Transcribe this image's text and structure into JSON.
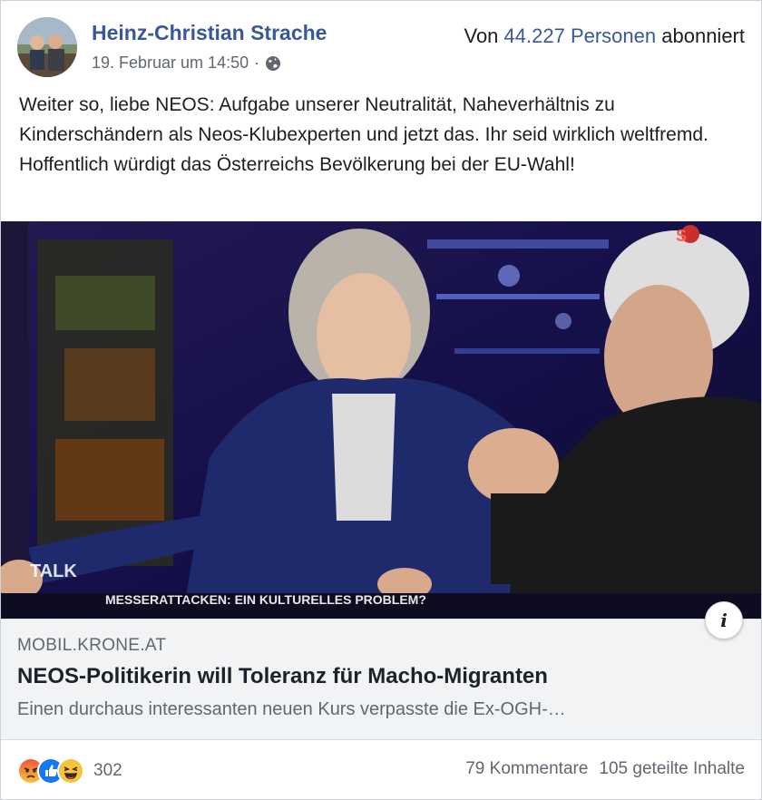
{
  "post": {
    "author": "Heinz-Christian Strache",
    "timestamp": "19. Februar um 14:50",
    "separator": "·",
    "privacy_icon": "globe-icon",
    "subscribed_prefix": "Von",
    "subscribed_count": "44.227 Personen",
    "subscribed_suffix": "abonniert",
    "text": "Weiter so, liebe NEOS: Aufgabe unserer Neutralität, Naheverhältnis zu Kinderschändern als Neos-Klubexperten und jetzt das. Ihr seid wirklich weltfremd. Hoffentlich würdigt das Österreichs Bevölkerung bei der EU-Wahl!"
  },
  "image": {
    "caption_tag": "TALK",
    "caption_text": "MESSERATTACKEN: EIN KULTURELLES PROBLEM?",
    "channel_logo": "S"
  },
  "link": {
    "domain": "MOBIL.KRONE.AT",
    "title": "NEOS-Politikerin will Toleranz für Macho-Migranten",
    "description": "Einen durchaus interessanten neuen Kurs verpasste die Ex-OGH-…",
    "info_label": "i"
  },
  "footer": {
    "reaction_icons": [
      "angry-icon",
      "like-icon",
      "haha-icon"
    ],
    "reaction_count": "302",
    "comments": "79 Kommentare",
    "shares": "105 geteilte Inhalte"
  },
  "colors": {
    "link_blue": "#385898",
    "meta_gray": "#606770",
    "link_box_bg": "#f2f3f5",
    "like_blue": "#1877f2",
    "angry_orange": "#f2563a",
    "haha_yellow": "#f7c33b"
  }
}
